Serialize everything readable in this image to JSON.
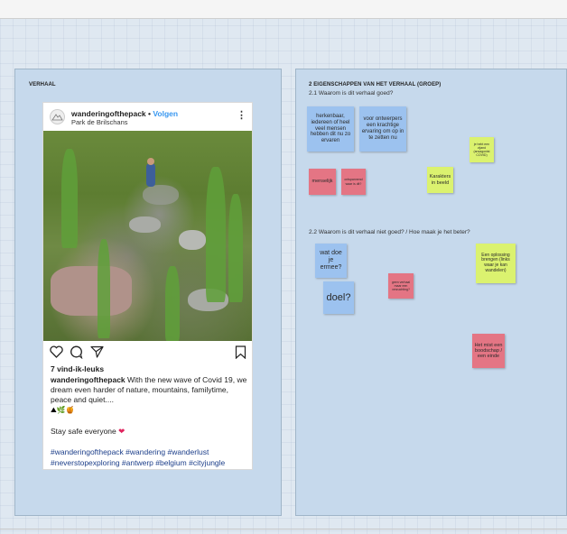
{
  "left_frame": {
    "title": "VERHAAL"
  },
  "post": {
    "username": "wanderingofthepack",
    "separator": " • ",
    "follow": "Volgen",
    "location": "Park de Brilschans",
    "likes": "7 vind-ik-leuks",
    "caption_user": "wanderingofthepack",
    "caption_text": " With the new wave of Covid 19, we dream even harder of nature, mountains, familytime, peace and quiet....",
    "emojis": "⛰🌿🍯",
    "stay_safe": "Stay safe everyone",
    "heart": "❤",
    "hashtags": "#wanderingofthepack #wandering #wanderlust #neverstopexploring #antwerp #belgium #cityjungle"
  },
  "right_frame": {
    "title": "2 EIGENSCHAPPEN VAN HET VERHAAL (GROEP)",
    "q1": "2.1 Waarom is dit verhaal goed?",
    "q2": "2.2 Waarom is dit verhaal niet goed? / Hoe maak je het beter?"
  },
  "stickies": {
    "s1": "herkenbaar, iedereen of heel veel mensen hebben dit nu zo ervaren",
    "s2": "voor ontwerpers een krachtige ervaring om op in te zetten nu",
    "s3": "je hebt een vijand (ansagonist COVID)",
    "s4": "menselijk",
    "s5": "ontspannend waar is dit?",
    "s6": "Karakters in beeld",
    "s7": "wat doe je ermee?",
    "s8": "doel?",
    "s9": "geen verhaal maar een verzuchting?",
    "s10": "Een oplossing brengen (links waar je kan wandelen)",
    "s11": "Het mist een boodschap / een einde"
  },
  "colors": {
    "blue": "#9cc2ef",
    "pink": "#e47584",
    "lime": "#dbf26f",
    "frame": "#c6d9ec",
    "link": "#3897f0"
  },
  "icons": [
    "heart-outline-icon",
    "comment-icon",
    "share-icon",
    "bookmark-icon",
    "more-icon"
  ]
}
